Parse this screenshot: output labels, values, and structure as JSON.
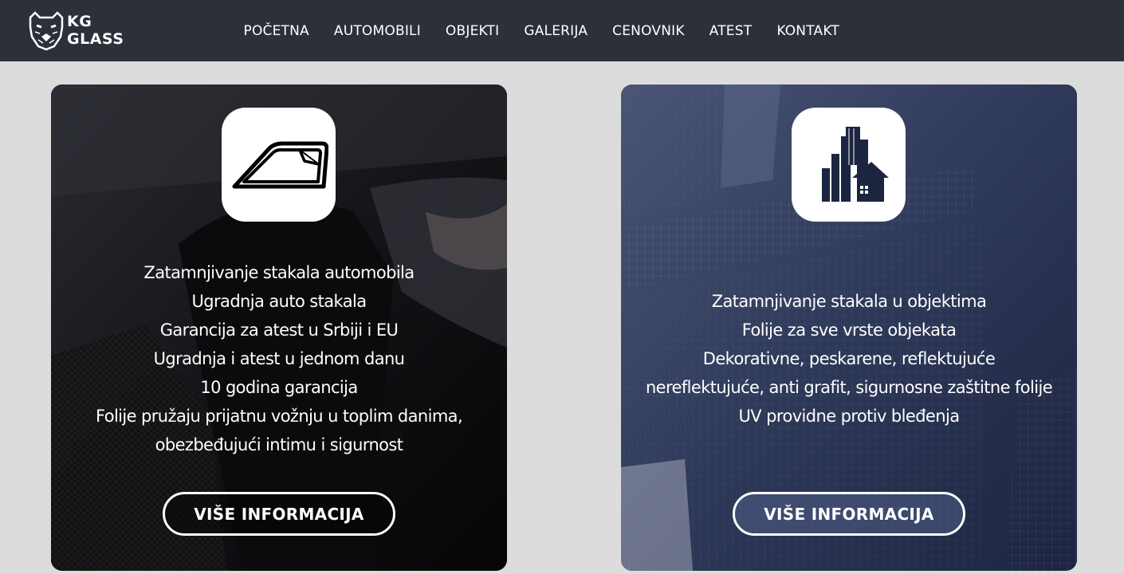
{
  "brand": {
    "line1": "KG",
    "line2": "GLASS",
    "logo_icon": "bear-head-icon"
  },
  "nav": {
    "items": [
      {
        "label": "POČETNA"
      },
      {
        "label": "AUTOMOBILI"
      },
      {
        "label": "OBJEKTI"
      },
      {
        "label": "GALERIJA"
      },
      {
        "label": "CENOVNIK"
      },
      {
        "label": "ATEST"
      },
      {
        "label": "KONTAKT"
      }
    ]
  },
  "cards": [
    {
      "icon": "car-window-icon",
      "lines": [
        "Zatamnjivanje stakala automobila",
        "Ugradnja auto stakala",
        "Garancija za atest u Srbiji i EU",
        "Ugradnja i atest u jednom danu",
        "10 godina garancija",
        "Folije pružaju prijatnu vožnju u toplim danima,",
        "obezbeđujući intimu i sigurnost"
      ],
      "button": "VIŠE INFORMACIJA"
    },
    {
      "icon": "buildings-icon",
      "lines": [
        "Zatamnjivanje stakala u objektima",
        "Folije za sve vrste objekata",
        "Dekorativne, peskarene, reflektujuće",
        "nereflektujuće, anti grafit, sigurnosne zaštitne folije",
        "UV providne protiv bleđenja"
      ],
      "button": "VIŠE INFORMACIJA"
    }
  ],
  "colors": {
    "nav_bg": "#2c3038",
    "page_bg": "#dcdcdc",
    "icon_dark": "#1c2540"
  }
}
